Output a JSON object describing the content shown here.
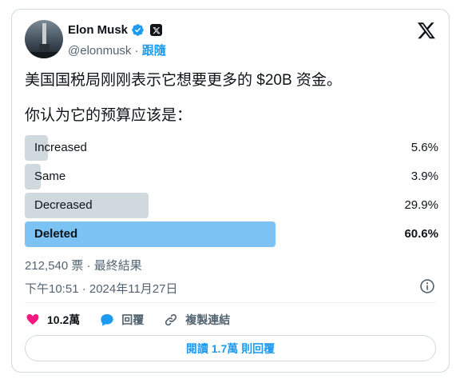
{
  "tweet": {
    "author_name": "Elon Musk",
    "handle": "@elonmusk",
    "separator": "·",
    "follow_label": "跟隨",
    "text_line1": "美国国税局刚刚表示它想要更多的 $20B 资金。",
    "text_line2": "你认为它的预算应该是："
  },
  "poll": {
    "options": [
      {
        "label": "Increased",
        "percent": "5.6%",
        "share": 5.6
      },
      {
        "label": "Same",
        "percent": "3.9%",
        "share": 3.9
      },
      {
        "label": "Decreased",
        "percent": "29.9%",
        "share": 29.9
      },
      {
        "label": "Deleted",
        "percent": "60.6%",
        "share": 60.6
      }
    ],
    "votes_line": "212,540 票 · 最終結果"
  },
  "timestamp": "下午10:51 · 2024年11月27日",
  "actions": {
    "like_count": "10.2萬",
    "reply_label": "回覆",
    "copy_link_label": "複製連結"
  },
  "read_replies_label": "閱讀 1.7萬 則回覆",
  "colors": {
    "accent": "#1d9bf0",
    "winner_bar": "#7cc2f3",
    "bar": "#cfd9de",
    "like": "#f91880"
  },
  "icons": [
    "verified-badge-icon",
    "x-affiliate-icon",
    "x-logo-icon",
    "info-icon",
    "heart-icon",
    "reply-bubble-icon",
    "link-icon"
  ]
}
